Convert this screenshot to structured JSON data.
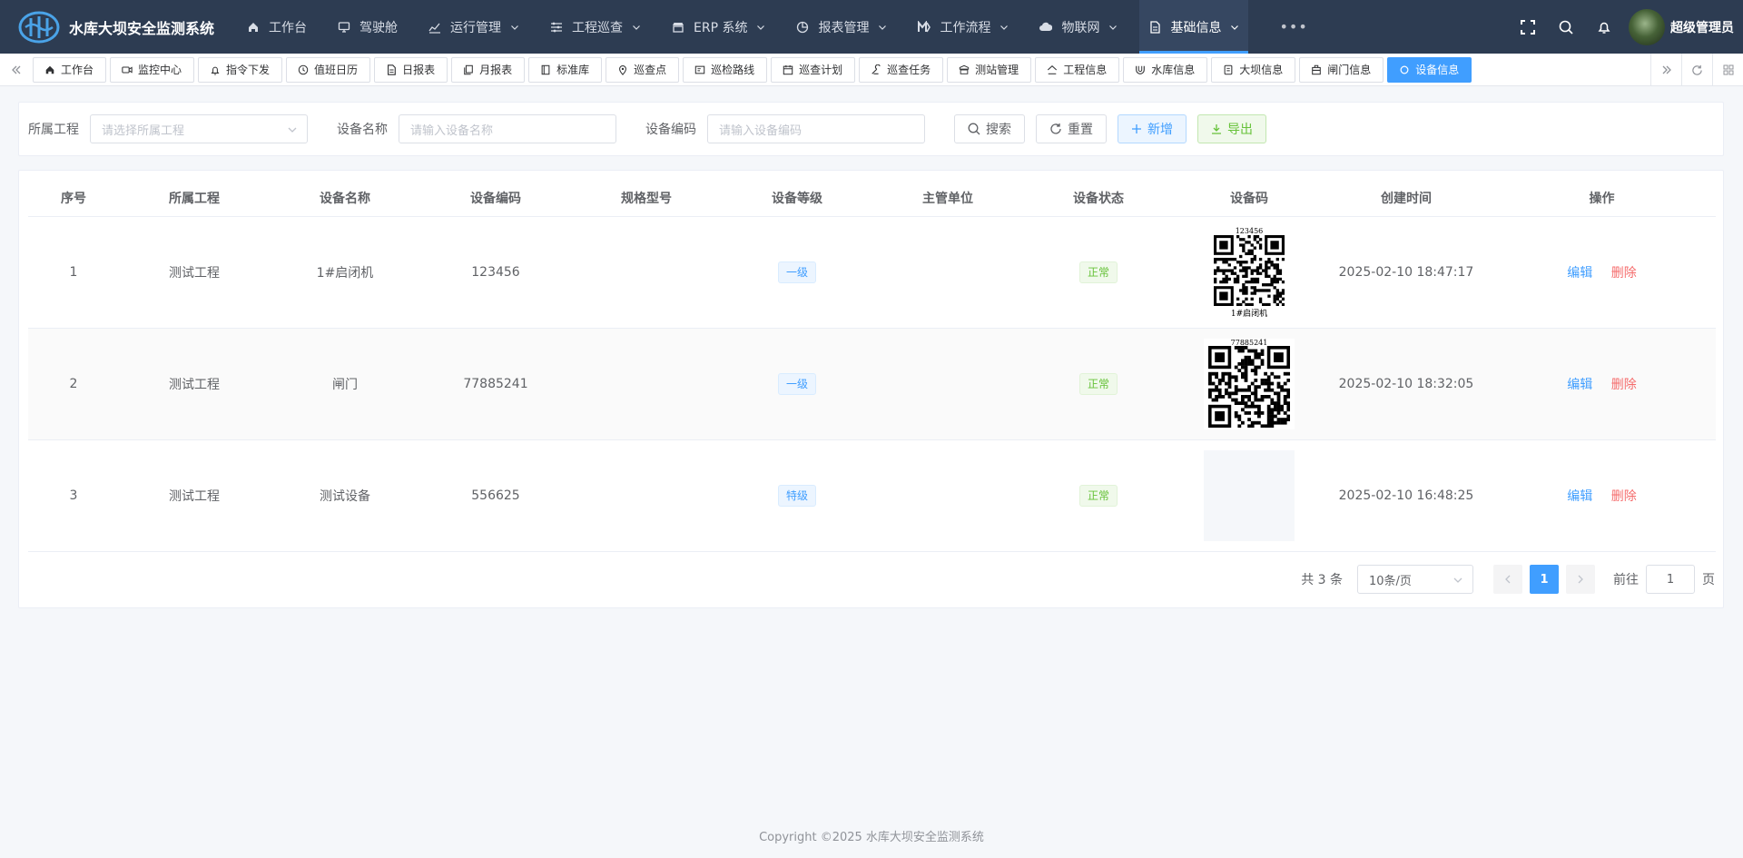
{
  "app": {
    "title": "水库大坝安全监测系统",
    "user": "超级管理员"
  },
  "nav": [
    {
      "label": "工作台",
      "icon": "home-icon",
      "caret": false,
      "active": false
    },
    {
      "label": "驾驶舱",
      "icon": "monitor-icon",
      "caret": false,
      "active": false
    },
    {
      "label": "运行管理",
      "icon": "chart-trend-icon",
      "caret": true,
      "active": false
    },
    {
      "label": "工程巡查",
      "icon": "sliders-icon",
      "caret": true,
      "active": false
    },
    {
      "label": "ERP 系统",
      "icon": "shop-icon",
      "caret": true,
      "active": false
    },
    {
      "label": "报表管理",
      "icon": "pie-chart-icon",
      "caret": true,
      "active": false
    },
    {
      "label": "工作流程",
      "icon": "workflow-icon",
      "caret": true,
      "active": false
    },
    {
      "label": "物联网",
      "icon": "cloud-icon",
      "caret": true,
      "active": false
    },
    {
      "label": "基础信息",
      "icon": "document-icon",
      "caret": true,
      "active": true
    }
  ],
  "tabs": [
    {
      "label": "工作台",
      "icon": "home-icon",
      "active": false
    },
    {
      "label": "监控中心",
      "icon": "video-camera-icon",
      "active": false
    },
    {
      "label": "指令下发",
      "icon": "bell-icon",
      "active": false
    },
    {
      "label": "值班日历",
      "icon": "clock-icon",
      "active": false
    },
    {
      "label": "日报表",
      "icon": "document-icon",
      "active": false
    },
    {
      "label": "月报表",
      "icon": "copy-document-icon",
      "active": false
    },
    {
      "label": "标准库",
      "icon": "notebook-icon",
      "active": false
    },
    {
      "label": "巡查点",
      "icon": "location-icon",
      "active": false
    },
    {
      "label": "巡检路线",
      "icon": "postcard-icon",
      "active": false
    },
    {
      "label": "巡查计划",
      "icon": "calendar-icon",
      "active": false
    },
    {
      "label": "巡查任务",
      "icon": "task-icon",
      "active": false
    },
    {
      "label": "测站管理",
      "icon": "station-icon",
      "active": false
    },
    {
      "label": "工程信息",
      "icon": "house-icon",
      "active": false
    },
    {
      "label": "水库信息",
      "icon": "reservoir-icon",
      "active": false
    },
    {
      "label": "大坝信息",
      "icon": "dam-icon",
      "active": false
    },
    {
      "label": "闸门信息",
      "icon": "gate-icon",
      "active": false
    },
    {
      "label": "设备信息",
      "icon": "circle-icon",
      "active": true
    }
  ],
  "search": {
    "project_label": "所属工程",
    "project_placeholder": "请选择所属工程",
    "name_label": "设备名称",
    "name_placeholder": "请输入设备名称",
    "code_label": "设备编码",
    "code_placeholder": "请输入设备编码",
    "search_btn": "搜索",
    "reset_btn": "重置",
    "add_btn": "新增",
    "export_btn": "导出"
  },
  "table": {
    "columns": [
      "序号",
      "所属工程",
      "设备名称",
      "设备编码",
      "规格型号",
      "设备等级",
      "主管单位",
      "设备状态",
      "设备码",
      "创建时间",
      "操作"
    ],
    "rows": [
      {
        "index": "1",
        "project": "测试工程",
        "name": "1#启闭机",
        "code": "123456",
        "model": "",
        "level": "一级",
        "unit": "",
        "status": "正常",
        "qr": {
          "top": "123456",
          "bottom": "1#启闭机",
          "seed": 7
        },
        "created": "2025-02-10 18:47:17"
      },
      {
        "index": "2",
        "project": "测试工程",
        "name": "闸门",
        "code": "77885241",
        "model": "",
        "level": "一级",
        "unit": "",
        "status": "正常",
        "qr": {
          "top": "77885241",
          "bottom": "",
          "seed": 19
        },
        "created": "2025-02-10 18:32:05"
      },
      {
        "index": "3",
        "project": "测试工程",
        "name": "测试设备",
        "code": "556625",
        "model": "",
        "level": "特级",
        "unit": "",
        "status": "正常",
        "qr": null,
        "created": "2025-02-10 16:48:25"
      }
    ],
    "edit_label": "编辑",
    "delete_label": "删除"
  },
  "pagination": {
    "total_text": "共 3 条",
    "page_size": "10条/页",
    "current_page": "1",
    "goto_label": "前往",
    "goto_value": "1",
    "page_suffix": "页"
  },
  "footer": "Copyright ©2025 水库大坝安全监测系统"
}
